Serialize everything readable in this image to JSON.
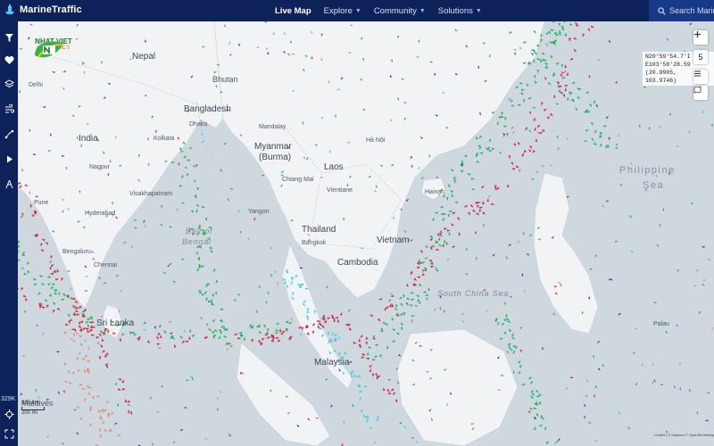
{
  "app": {
    "brand": "MarineTraffic"
  },
  "nav": [
    {
      "label": "Live Map",
      "active": true
    },
    {
      "label": "Explore"
    },
    {
      "label": "Community"
    },
    {
      "label": "Solutions"
    }
  ],
  "search": {
    "placeholder": "Search MarineTraffic"
  },
  "rail": {
    "vessel_count": "329K"
  },
  "logo_overlay": {
    "name": "NHAT VIET",
    "sub": "LOGISTICS"
  },
  "coords": {
    "lat": "N20°59'54.7'I",
    "lon": "E103°58'28.59",
    "decimal": "(20.9905, 103.9746)"
  },
  "right_controls": {
    "layers_count": "5"
  },
  "scale": {
    "top": "300 km",
    "bottom": "200 mi"
  },
  "attribution": "Leaflet | © Mapbox © OpenStreetMap",
  "places": {
    "nepal": "Nepal",
    "bhutan": "Bhutan",
    "bangladesh": "Bangladesh",
    "india": "India",
    "myanmar": "Myanmar",
    "burma": "(Burma)",
    "laos": "Laos",
    "thailand": "Thailand",
    "bangkok": "Bangkok",
    "cambodia": "Cambodia",
    "vietnam": "Vietnam",
    "sri_lanka": "Sri Lanka",
    "maldives": "Maldives",
    "malaysia": "Malaysia",
    "philippine_sea_1": "Philippine",
    "philippine_sea_2": "Sea",
    "delhi": "Delhi",
    "dhaka": "Dhaka",
    "kolkata": "Kolkata",
    "hyderabad": "Hyderabad",
    "bengaluru": "Bengaluru",
    "pune": "Pune",
    "nagpur": "Nagpur",
    "visakhapatnam": "Visakhapatnam",
    "chennai": "Chennai",
    "yangon": "Yangon",
    "mandalay": "Mandalay",
    "chiang_mai": "Chiang Mai",
    "vientiane": "Vientiane",
    "hanoi": "Hà Nội",
    "hainan": "Hainan",
    "bay_of_bengal_1": "Bay of",
    "bay_of_bengal_2": "Bengal",
    "south_china_sea": "South China Sea",
    "palau": "Palau"
  },
  "colors": {
    "topbar": "#0d2258",
    "land": "#f1f3f5",
    "water": "#cfd7df",
    "ship_cargo": "#21b35a",
    "ship_tanker": "#d8203a",
    "ship_passenger": "#3ecfe0",
    "ship_fishing": "#e58a6e",
    "ship_other": "#b05fd6",
    "ship_tug": "#2f3fa8"
  }
}
